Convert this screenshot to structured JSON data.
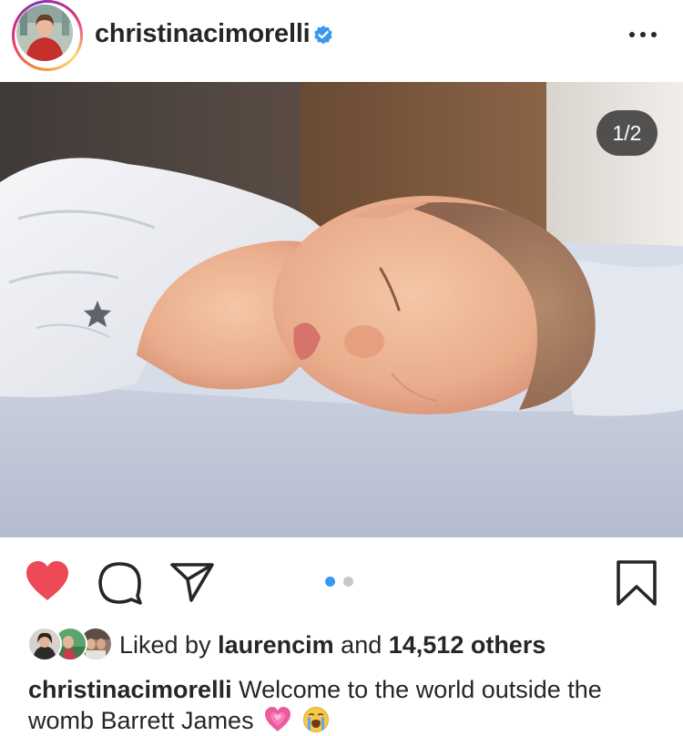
{
  "post": {
    "username": "christinacimorelli",
    "verified": true,
    "more_icon": "more-horizontal-icon",
    "image_counter": "1/2",
    "carousel": {
      "current": 1,
      "total": 2
    }
  },
  "actions": {
    "like_icon": "heart-filled-icon",
    "comment_icon": "comment-icon",
    "share_icon": "paper-plane-icon",
    "save_icon": "bookmark-icon",
    "like_color": "#ed4956"
  },
  "likes": {
    "prefix": "Liked by",
    "user": "laurencim",
    "middle": "and",
    "others": "14,512 others"
  },
  "caption": {
    "username": "christinacimorelli",
    "text": "Welcome to the world outside the womb Barrett James",
    "emojis": [
      "growing-heart-emoji",
      "loudly-crying-face-emoji"
    ]
  },
  "colors": {
    "accent": "#3897f0",
    "verified": "#3897f0",
    "text": "#262626"
  }
}
